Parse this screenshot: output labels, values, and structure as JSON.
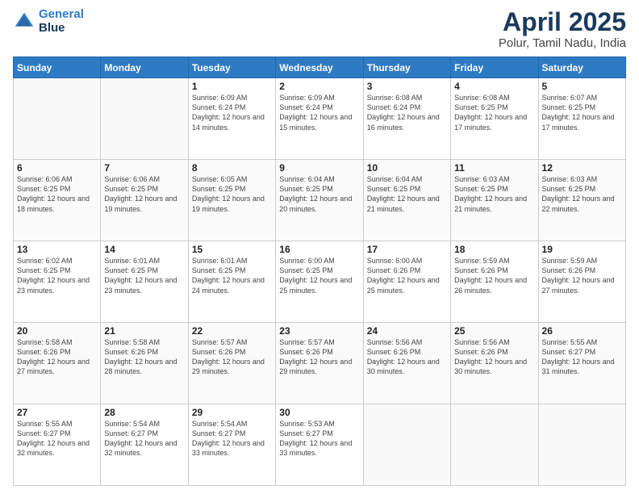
{
  "header": {
    "logo_line1": "General",
    "logo_line2": "Blue",
    "title": "April 2025",
    "subtitle": "Polur, Tamil Nadu, India"
  },
  "calendar": {
    "days_of_week": [
      "Sunday",
      "Monday",
      "Tuesday",
      "Wednesday",
      "Thursday",
      "Friday",
      "Saturday"
    ],
    "weeks": [
      [
        {
          "day": "",
          "info": ""
        },
        {
          "day": "",
          "info": ""
        },
        {
          "day": "1",
          "info": "Sunrise: 6:09 AM\nSunset: 6:24 PM\nDaylight: 12 hours and 14 minutes."
        },
        {
          "day": "2",
          "info": "Sunrise: 6:09 AM\nSunset: 6:24 PM\nDaylight: 12 hours and 15 minutes."
        },
        {
          "day": "3",
          "info": "Sunrise: 6:08 AM\nSunset: 6:24 PM\nDaylight: 12 hours and 16 minutes."
        },
        {
          "day": "4",
          "info": "Sunrise: 6:08 AM\nSunset: 6:25 PM\nDaylight: 12 hours and 17 minutes."
        },
        {
          "day": "5",
          "info": "Sunrise: 6:07 AM\nSunset: 6:25 PM\nDaylight: 12 hours and 17 minutes."
        }
      ],
      [
        {
          "day": "6",
          "info": "Sunrise: 6:06 AM\nSunset: 6:25 PM\nDaylight: 12 hours and 18 minutes."
        },
        {
          "day": "7",
          "info": "Sunrise: 6:06 AM\nSunset: 6:25 PM\nDaylight: 12 hours and 19 minutes."
        },
        {
          "day": "8",
          "info": "Sunrise: 6:05 AM\nSunset: 6:25 PM\nDaylight: 12 hours and 19 minutes."
        },
        {
          "day": "9",
          "info": "Sunrise: 6:04 AM\nSunset: 6:25 PM\nDaylight: 12 hours and 20 minutes."
        },
        {
          "day": "10",
          "info": "Sunrise: 6:04 AM\nSunset: 6:25 PM\nDaylight: 12 hours and 21 minutes."
        },
        {
          "day": "11",
          "info": "Sunrise: 6:03 AM\nSunset: 6:25 PM\nDaylight: 12 hours and 21 minutes."
        },
        {
          "day": "12",
          "info": "Sunrise: 6:03 AM\nSunset: 6:25 PM\nDaylight: 12 hours and 22 minutes."
        }
      ],
      [
        {
          "day": "13",
          "info": "Sunrise: 6:02 AM\nSunset: 6:25 PM\nDaylight: 12 hours and 23 minutes."
        },
        {
          "day": "14",
          "info": "Sunrise: 6:01 AM\nSunset: 6:25 PM\nDaylight: 12 hours and 23 minutes."
        },
        {
          "day": "15",
          "info": "Sunrise: 6:01 AM\nSunset: 6:25 PM\nDaylight: 12 hours and 24 minutes."
        },
        {
          "day": "16",
          "info": "Sunrise: 6:00 AM\nSunset: 6:25 PM\nDaylight: 12 hours and 25 minutes."
        },
        {
          "day": "17",
          "info": "Sunrise: 6:00 AM\nSunset: 6:26 PM\nDaylight: 12 hours and 25 minutes."
        },
        {
          "day": "18",
          "info": "Sunrise: 5:59 AM\nSunset: 6:26 PM\nDaylight: 12 hours and 26 minutes."
        },
        {
          "day": "19",
          "info": "Sunrise: 5:59 AM\nSunset: 6:26 PM\nDaylight: 12 hours and 27 minutes."
        }
      ],
      [
        {
          "day": "20",
          "info": "Sunrise: 5:58 AM\nSunset: 6:26 PM\nDaylight: 12 hours and 27 minutes."
        },
        {
          "day": "21",
          "info": "Sunrise: 5:58 AM\nSunset: 6:26 PM\nDaylight: 12 hours and 28 minutes."
        },
        {
          "day": "22",
          "info": "Sunrise: 5:57 AM\nSunset: 6:26 PM\nDaylight: 12 hours and 29 minutes."
        },
        {
          "day": "23",
          "info": "Sunrise: 5:57 AM\nSunset: 6:26 PM\nDaylight: 12 hours and 29 minutes."
        },
        {
          "day": "24",
          "info": "Sunrise: 5:56 AM\nSunset: 6:26 PM\nDaylight: 12 hours and 30 minutes."
        },
        {
          "day": "25",
          "info": "Sunrise: 5:56 AM\nSunset: 6:26 PM\nDaylight: 12 hours and 30 minutes."
        },
        {
          "day": "26",
          "info": "Sunrise: 5:55 AM\nSunset: 6:27 PM\nDaylight: 12 hours and 31 minutes."
        }
      ],
      [
        {
          "day": "27",
          "info": "Sunrise: 5:55 AM\nSunset: 6:27 PM\nDaylight: 12 hours and 32 minutes."
        },
        {
          "day": "28",
          "info": "Sunrise: 5:54 AM\nSunset: 6:27 PM\nDaylight: 12 hours and 32 minutes."
        },
        {
          "day": "29",
          "info": "Sunrise: 5:54 AM\nSunset: 6:27 PM\nDaylight: 12 hours and 33 minutes."
        },
        {
          "day": "30",
          "info": "Sunrise: 5:53 AM\nSunset: 6:27 PM\nDaylight: 12 hours and 33 minutes."
        },
        {
          "day": "",
          "info": ""
        },
        {
          "day": "",
          "info": ""
        },
        {
          "day": "",
          "info": ""
        }
      ]
    ]
  }
}
